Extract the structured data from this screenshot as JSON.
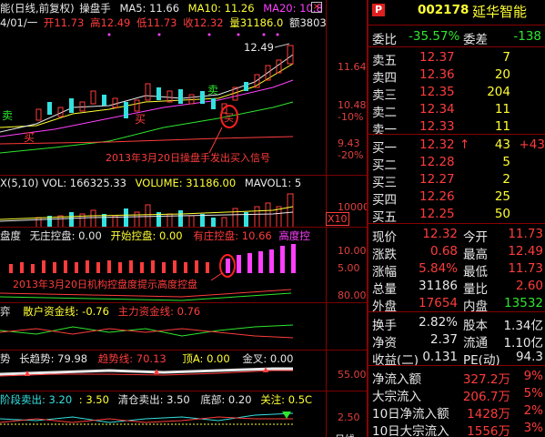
{
  "header": {
    "title_prefix": "能(日线,前复权)",
    "indicator": "操盘手",
    "ma5": "MA5: 11.66",
    "ma10": "MA10: 11.26",
    "ma20": "MA20: 10.8",
    "info_date": "4/01/一",
    "info_open": "开11.73",
    "info_high": "高12.49",
    "info_low": "低11.73",
    "info_close": "收12.32",
    "info_volume": "量31186.0",
    "info_amount": "额3803"
  },
  "price_panel": {
    "high_label": "12.49",
    "price_ticks": [
      "11.64",
      "10.48",
      "9.43"
    ],
    "pct_ticks": [
      "-10%",
      "-20%"
    ],
    "buy_labels": [
      "买",
      "买",
      "买"
    ],
    "sell_labels": [
      "卖",
      "卖",
      "卖"
    ],
    "circle_label": "买",
    "annotation": "2013年3月20日操盘手发出买入信号"
  },
  "volume_panel": {
    "label": "X(5,10)  VOL: 166325.33",
    "volume": "VOLUME: 31186.00",
    "mavol": "MAVOL1: 5",
    "tick": "10000",
    "unit": "X10"
  },
  "control_panel": {
    "label1": "盘度",
    "label2": "无庄控盘: 0.00",
    "label3": "开始控盘: 0.00",
    "label4": "有庄控盘: 10.66",
    "label5": "高度控",
    "ticks": [
      "10.00",
      "5.00"
    ],
    "annotation": "2013年3月20日机构控盘度提示高度控盘"
  },
  "fund_panel": {
    "label1": "弈",
    "label2": "散户资金线: -0.76",
    "label3": "主力资金线: 0.76",
    "tick": "80.00"
  },
  "trend_panel": {
    "label1": "势",
    "label2": "长趋势: 79.98",
    "label3": "趋势线: 70.13",
    "label4": "顶A: 0.00",
    "label5": "金叉: 0.00",
    "tick": "55.00"
  },
  "phase_panel": {
    "label1": "阶段卖出: 3.20",
    "label2": ": 3.50",
    "label3": "清仓卖出: 3.50",
    "label4": "底部: 0.20",
    "label5": "关注: 0.5C",
    "tick": "2.50",
    "bottom_text": "日线"
  },
  "quote": {
    "badge": "P",
    "code": "002178",
    "name": "延华智能",
    "weibi_label": "委比",
    "weibi_value": "-35.57%",
    "weicha_label": "委差",
    "weicha_value": "-138",
    "asks": [
      {
        "label": "卖五",
        "price": "12.37",
        "vol": "7"
      },
      {
        "label": "卖四",
        "price": "12.36",
        "vol": "20"
      },
      {
        "label": "卖三",
        "price": "12.35",
        "vol": "204"
      },
      {
        "label": "卖二",
        "price": "12.34",
        "vol": "11"
      },
      {
        "label": "卖一",
        "price": "12.33",
        "vol": "11"
      }
    ],
    "bids": [
      {
        "label": "买一",
        "price": "12.32",
        "vol": "43",
        "arrow": "↑",
        "extra": "+43"
      },
      {
        "label": "买二",
        "price": "12.28",
        "vol": "5"
      },
      {
        "label": "买三",
        "price": "12.27",
        "vol": "2"
      },
      {
        "label": "买四",
        "price": "12.26",
        "vol": "25"
      },
      {
        "label": "买五",
        "price": "12.25",
        "vol": "50"
      }
    ],
    "stats": [
      {
        "l1": "现价",
        "v1": "12.32",
        "c1": "red",
        "l2": "今开",
        "v2": "11.73",
        "c2": "red"
      },
      {
        "l1": "涨跌",
        "v1": "0.68",
        "c1": "red",
        "l2": "最高",
        "v2": "12.49",
        "c2": "red"
      },
      {
        "l1": "涨幅",
        "v1": "5.84%",
        "c1": "red",
        "l2": "最低",
        "v2": "11.73",
        "c2": "red"
      },
      {
        "l1": "总量",
        "v1": "31186",
        "c1": "white",
        "l2": "量比",
        "v2": "2.60",
        "c2": "red"
      },
      {
        "l1": "外盘",
        "v1": "17654",
        "c1": "red",
        "l2": "内盘",
        "v2": "13532",
        "c2": "green"
      }
    ],
    "stats2": [
      {
        "l1": "换手",
        "v1": "2.82%",
        "l2": "股本",
        "v2": "1.34亿"
      },
      {
        "l1": "净资",
        "v1": "2.37",
        "l2": "流通",
        "v2": "1.10亿"
      },
      {
        "l1": "收益(二)",
        "v1": "0.131",
        "l2": "PE(动)",
        "v2": "94.3"
      }
    ],
    "flows": [
      {
        "label": "净流入额",
        "value": "327.2万",
        "pct": "9%"
      },
      {
        "label": "大宗流入",
        "value": "206.7万",
        "pct": "5%"
      },
      {
        "label": "10日净流入额",
        "value": "1428万",
        "pct": "2%"
      },
      {
        "label": "10日大宗流入",
        "value": "1556万",
        "pct": "3%"
      }
    ]
  },
  "colors": {
    "up": "#ff3c3c",
    "down": "#2ee62e",
    "border": "#8a0000",
    "label": "#ffff33"
  }
}
